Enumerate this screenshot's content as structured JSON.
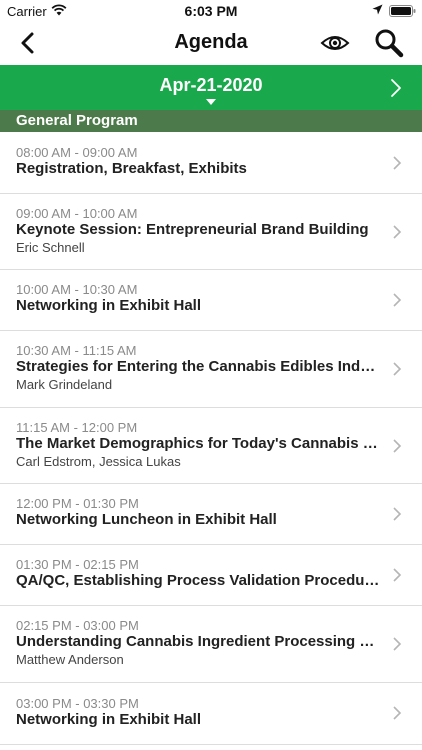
{
  "status_bar": {
    "carrier": "Carrier",
    "time": "6:03 PM"
  },
  "nav": {
    "title": "Agenda",
    "icons": [
      "back-chevron-icon",
      "eye-icon",
      "search-icon"
    ]
  },
  "date_bar": {
    "date": "Apr-21-2020",
    "color": "#1aa84d"
  },
  "section": {
    "title": "General Program",
    "color": "#4d7a4a"
  },
  "sessions": [
    {
      "time": "08:00 AM - 09:00 AM",
      "title": "Registration, Breakfast, Exhibits",
      "speaker": ""
    },
    {
      "time": "09:00 AM - 10:00 AM",
      "title": "Keynote Session: Entrepreneurial Brand Building",
      "speaker": "Eric Schnell"
    },
    {
      "time": "10:00 AM - 10:30 AM",
      "title": "Networking in Exhibit Hall",
      "speaker": ""
    },
    {
      "time": "10:30 AM - 11:15 AM",
      "title": "Strategies for Entering the Cannabis Edibles Industry",
      "speaker": "Mark Grindeland"
    },
    {
      "time": "11:15 AM - 12:00 PM",
      "title": "The Market Demographics for Today's Cannabis Co...",
      "speaker": "Carl Edstrom, Jessica Lukas"
    },
    {
      "time": "12:00 PM - 01:30 PM",
      "title": "Networking Luncheon in Exhibit Hall",
      "speaker": ""
    },
    {
      "time": "01:30 PM - 02:15 PM",
      "title": "QA/QC, Establishing Process Validation Procedures",
      "speaker": ""
    },
    {
      "time": "02:15 PM - 03:00 PM",
      "title": "Understanding Cannabis Ingredient Processing Dyn...",
      "speaker": "Matthew Anderson"
    },
    {
      "time": "03:00 PM - 03:30 PM",
      "title": "Networking in Exhibit Hall",
      "speaker": ""
    }
  ]
}
